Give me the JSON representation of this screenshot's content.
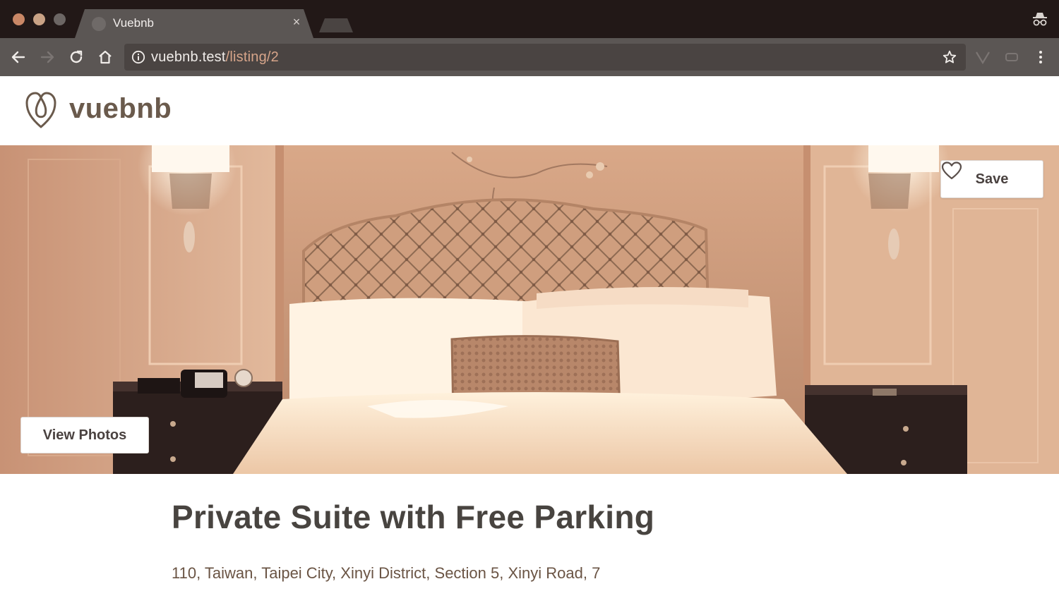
{
  "browser": {
    "tab_title": "Vuebnb",
    "tab_close": "×",
    "url_host": "vuebnb.test",
    "url_path": "/listing/2"
  },
  "navbar": {
    "brand": "vuebnb"
  },
  "hero": {
    "save_label": "Save",
    "view_photos_label": "View Photos"
  },
  "listing": {
    "title": "Private Suite with Free Parking",
    "address": "110, Taiwan, Taipei City, Xinyi District, Section 5, Xinyi Road, 7"
  },
  "icons": {
    "logo": "vuebnb-logo-icon",
    "save": "heart-icon",
    "back": "back-arrow-icon",
    "forward": "forward-arrow-icon",
    "reload": "reload-icon",
    "home": "home-icon",
    "info": "info-icon",
    "bookmark": "star-icon",
    "incognito": "incognito-icon"
  },
  "colors": {
    "brand_text": "#6a5a4c",
    "title_text": "#484440",
    "address_text": "#6a5444",
    "chrome_dark": "#221817",
    "chrome_toolbar": "#5b5654"
  }
}
